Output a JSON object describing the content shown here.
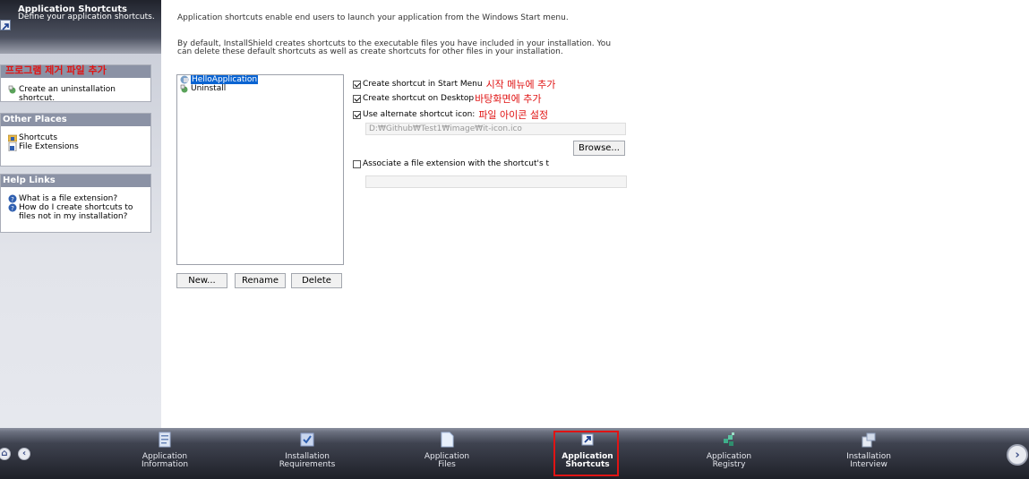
{
  "header": {
    "title": "Application Shortcuts",
    "subtitle": "Define your application shortcuts."
  },
  "left_panels": {
    "tasks": {
      "header_overlay": "프로그램 제거 파일 추가",
      "items": [
        {
          "label": "Create an uninstallation shortcut.",
          "icon": "uninstall-shortcut-icon"
        }
      ]
    },
    "other_places": {
      "title": "Other Places",
      "items": [
        {
          "label": "Shortcuts",
          "icon": "folder-icon"
        },
        {
          "label": "File Extensions",
          "icon": "file-extensions-icon"
        }
      ]
    },
    "help_links": {
      "title": "Help Links",
      "items": [
        {
          "label": "What is a file extension?",
          "icon": "help-icon"
        },
        {
          "label": "How do I create shortcuts to files not in my installation?",
          "icon": "help-icon"
        }
      ]
    }
  },
  "main": {
    "intro1": "Application shortcuts enable end users to launch your application from the Windows Start menu.",
    "intro2": "By default, InstallShield creates shortcuts to the executable files you have included in your installation. You can delete these default shortcuts as well as create shortcuts for other files in your installation.",
    "shortcut_list": [
      {
        "label": "HelloApplication",
        "selected": true
      },
      {
        "label": "Uninstall",
        "selected": false
      }
    ],
    "buttons": {
      "new": "New...",
      "rename": "Rename",
      "delete": "Delete",
      "browse": "Browse..."
    },
    "options": {
      "start_menu": {
        "label": "Create shortcut in Start Menu",
        "checked": true,
        "note": "시작 메뉴에 추가"
      },
      "desktop": {
        "label": "Create shortcut on Desktop",
        "checked": true,
        "note": "바탕화면에 추가"
      },
      "alt_icon": {
        "label": "Use alternate shortcut icon:",
        "checked": true,
        "note": "파일 아이콘 설정"
      },
      "icon_path": "D:₩Github₩Test1₩image₩it-icon.ico",
      "assoc": {
        "label": "Associate a file extension with the shortcut's t",
        "checked": false
      },
      "extension_value": ""
    }
  },
  "nav": {
    "items": [
      {
        "line1": "Application",
        "line2": "Information",
        "icon": "application-information-icon"
      },
      {
        "line1": "Installation",
        "line2": "Requirements",
        "icon": "installation-requirements-icon"
      },
      {
        "line1": "Application",
        "line2": "Files",
        "icon": "application-files-icon"
      },
      {
        "line1": "Application",
        "line2": "Shortcuts",
        "icon": "application-shortcuts-icon",
        "active": true
      },
      {
        "line1": "Application",
        "line2": "Registry",
        "icon": "application-registry-icon"
      },
      {
        "line1": "Installation",
        "line2": "Interview",
        "icon": "installation-interview-icon"
      }
    ]
  },
  "colors": {
    "accent_red": "#e01414",
    "selection_blue": "#0a64d2",
    "panel_header": "#8b92a5"
  }
}
